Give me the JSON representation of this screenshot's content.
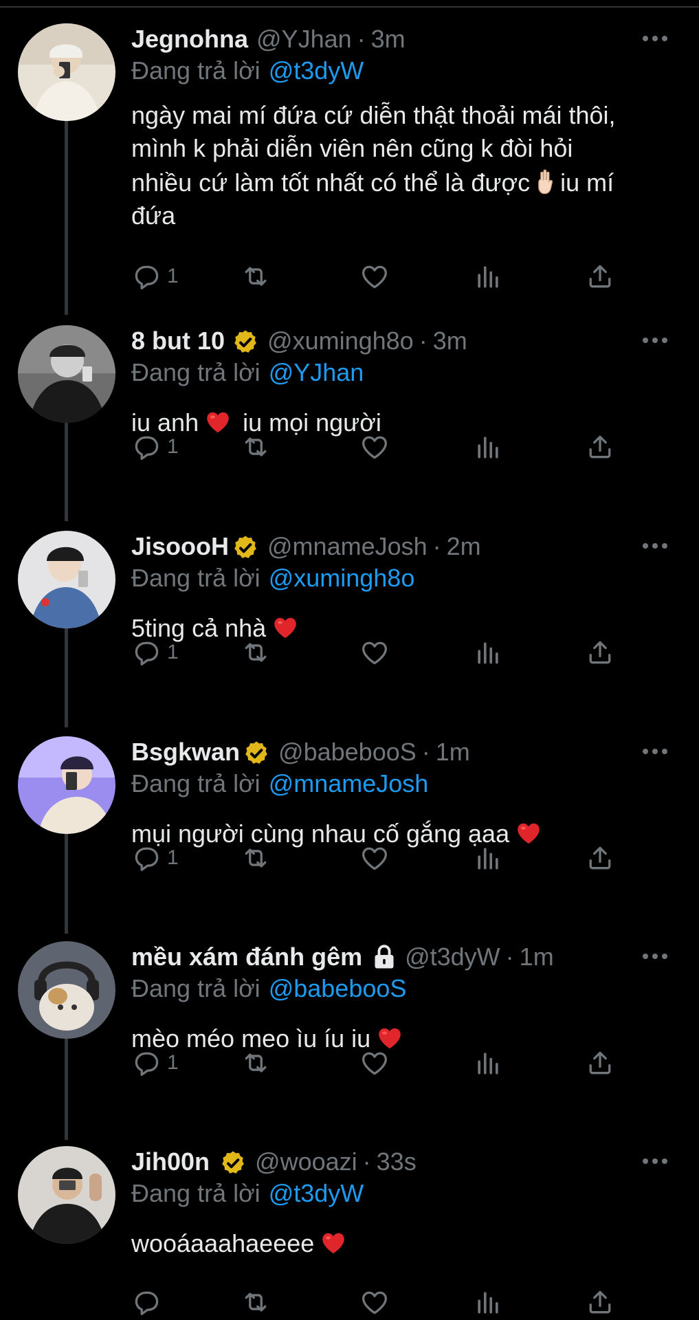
{
  "colors": {
    "background": "#000000",
    "text": "#e7e9ea",
    "muted": "#71767b",
    "link": "#1d9bf0",
    "verified": "#e2b719",
    "heart": "#e0262a"
  },
  "reply_prefix": "Đang trả lời",
  "tweets": [
    {
      "name": "Jegnohna",
      "handle": "@YJhan",
      "time": "3m",
      "reply_to": "@t3dyW",
      "text_lines": [
        "ngày mai mí đứa cứ diễn thật thoải mái thôi,",
        "mình k phải diễn viên nên cũng k đòi hỏi"
      ],
      "text_last_a": "nhiều cứ làm tốt nhất có thể là được",
      "text_last_b": "iu mí",
      "text_last_c": "đứa",
      "reply_count": "1",
      "verified": false,
      "locked": false,
      "emoji": "hand-emoji"
    },
    {
      "name": "8 but 10",
      "handle": "@xumingh8o",
      "time": "3m",
      "reply_to": "@YJhan",
      "text_a": "iu anh",
      "text_b": "iu mọi người",
      "reply_count": "1",
      "verified": true,
      "locked": false
    },
    {
      "name": "JisoooH",
      "handle": "@mnameJosh",
      "time": "2m",
      "reply_to": "@xumingh8o",
      "text_a": "5ting cả nhà",
      "reply_count": "1",
      "verified": true,
      "locked": false
    },
    {
      "name": "Bsgkwan",
      "handle": "@babebooS",
      "time": "1m",
      "reply_to": "@mnameJosh",
      "text_a": "mụi người cùng nhau cố gắng ạaa",
      "reply_count": "1",
      "verified": true,
      "locked": false
    },
    {
      "name": "mều xám đánh gêm",
      "handle": "@t3dyW",
      "time": "1m",
      "reply_to": "@babebooS",
      "text_a": "mèo méo meo ìu íu iu",
      "reply_count": "1",
      "verified": false,
      "locked": true
    },
    {
      "name": "Jih00n",
      "handle": "@wooazi",
      "time": "33s",
      "reply_to": "@t3dyW",
      "text_a": "wooáaaahaeeee",
      "reply_count": "",
      "verified": true,
      "locked": false
    }
  ],
  "icons": [
    "reply-icon",
    "retweet-icon",
    "like-icon",
    "views-icon",
    "share-icon",
    "more-icon",
    "verified-badge-icon",
    "lock-icon",
    "red-heart-emoji",
    "hand-emoji"
  ]
}
